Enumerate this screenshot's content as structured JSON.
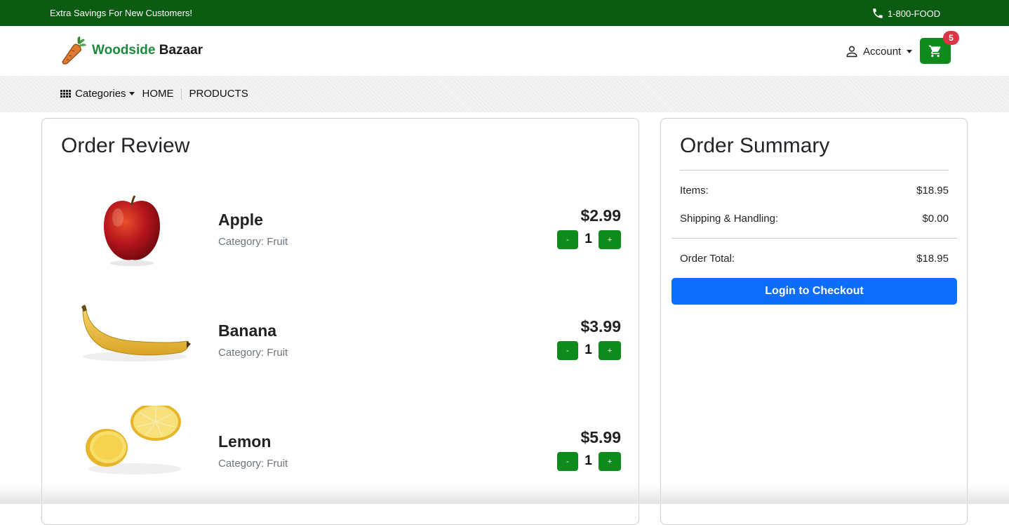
{
  "topbar": {
    "promo": "Extra Savings For New Customers!",
    "phone": "1-800-FOOD"
  },
  "brand": {
    "first": "Woodside",
    "second": "Bazaar"
  },
  "header": {
    "account_label": "Account",
    "cart_count": "5"
  },
  "nav": {
    "categories_label": "Categories",
    "home_label": "HOME",
    "products_label": "PRODUCTS"
  },
  "review": {
    "title": "Order Review",
    "items": [
      {
        "name": "Apple",
        "category": "Category: Fruit",
        "price": "$2.99",
        "quantity": "1",
        "minus": "-",
        "plus": "+"
      },
      {
        "name": "Banana",
        "category": "Category: Fruit",
        "price": "$3.99",
        "quantity": "1",
        "minus": "-",
        "plus": "+"
      },
      {
        "name": "Lemon",
        "category": "Category: Fruit",
        "price": "$5.99",
        "quantity": "1",
        "minus": "-",
        "plus": "+"
      }
    ]
  },
  "summary": {
    "title": "Order Summary",
    "items_label": "Items:",
    "items_value": "$18.95",
    "shipping_label": "Shipping & Handling:",
    "shipping_value": "$0.00",
    "total_label": "Order Total:",
    "total_value": "$18.95",
    "checkout_label": "Login to Checkout"
  },
  "colors": {
    "topbar": "#0b5b12",
    "brand_green": "#1e8a3c",
    "button_green": "#0f8a1c",
    "primary_blue": "#0d6efd",
    "badge_red": "#dc3545"
  },
  "icons": {
    "phone": "phone-icon",
    "account": "user-icon",
    "cart": "cart-icon",
    "categories": "grid-icon",
    "logo": "carrot-icon"
  }
}
